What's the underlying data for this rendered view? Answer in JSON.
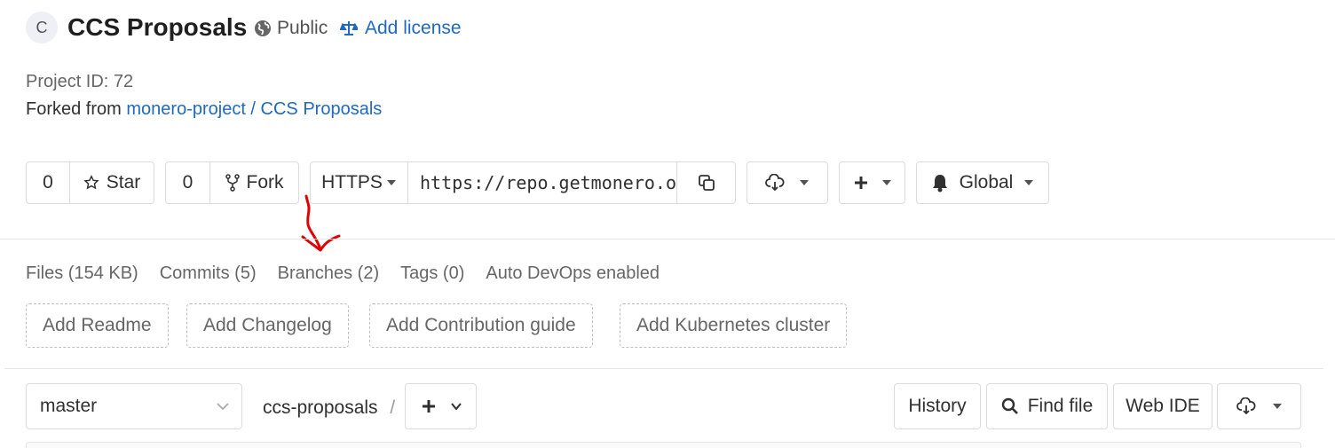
{
  "project": {
    "avatar_letter": "C",
    "title": "CCS Proposals",
    "visibility": "Public",
    "add_license": "Add license",
    "project_id": "Project ID: 72",
    "forked_from_label": "Forked from",
    "forked_from_link": "monero-project / CCS Proposals"
  },
  "actions": {
    "star_count": "0",
    "star_label": "Star",
    "fork_count": "0",
    "fork_label": "Fork",
    "protocol": "HTTPS",
    "clone_url": "https://repo.getmonero.org/monero-project/ccs-proposals.git",
    "notification_level": "Global"
  },
  "stats": {
    "files": "Files (154 KB)",
    "commits": "Commits (5)",
    "branches": "Branches (2)",
    "tags": "Tags (0)",
    "devops": "Auto DevOps enabled"
  },
  "quick_add": {
    "readme": "Add Readme",
    "changelog": "Add Changelog",
    "contribution": "Add Contribution guide",
    "kubernetes": "Add Kubernetes cluster"
  },
  "tree": {
    "branch": "master",
    "path": "ccs-proposals",
    "path_sep": "/",
    "history": "History",
    "find_file": "Find file",
    "web_ide": "Web IDE"
  },
  "colors": {
    "link": "#1f69c0",
    "annotation_arrow": "#e00000"
  }
}
